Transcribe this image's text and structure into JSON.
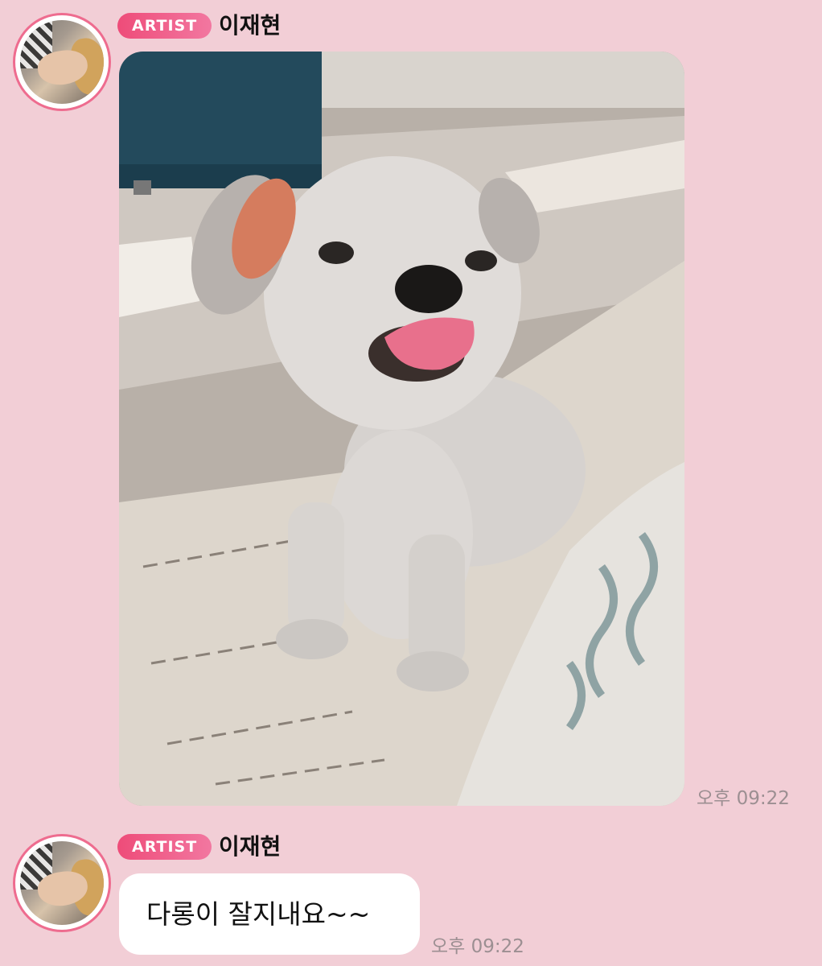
{
  "messages": [
    {
      "sender_badge": "ARTIST",
      "sender_name": "이재현",
      "type": "photo",
      "photo_subject": "white shih tzu dog sticking out tongue",
      "time": "오후 09:22"
    },
    {
      "sender_badge": "ARTIST",
      "sender_name": "이재현",
      "type": "text",
      "text": "다롱이 잘지내요~~",
      "time": "오후 09:22"
    }
  ],
  "colors": {
    "background": "#f2ced6",
    "badge_start": "#ee4c79",
    "badge_end": "#f277a0",
    "avatar_ring": "#ee6c8f",
    "bubble": "#ffffff",
    "time_text": "#9c8f92"
  }
}
